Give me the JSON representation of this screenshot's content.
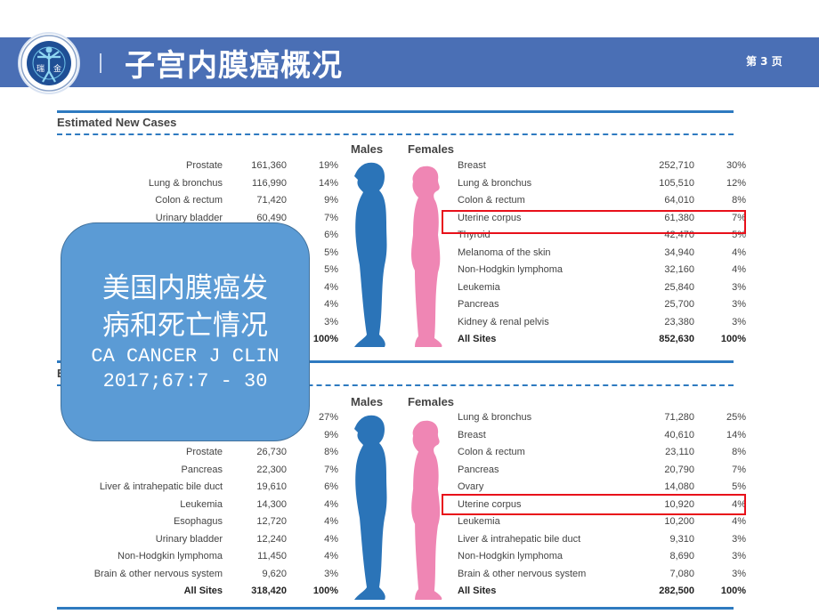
{
  "header": {
    "logo_icon": "hospital-emblem-icon",
    "logo_char_left": "瑞",
    "logo_char_right": "金",
    "title": "子宫内膜癌概况",
    "page_label": "第 3 页",
    "bar_color": "#4a6fb5"
  },
  "new_cases": {
    "title": "Estimated New Cases",
    "males_label": "Males",
    "females_label": "Females",
    "males": [
      {
        "site": "Prostate",
        "count": "161,360",
        "pct": "19%"
      },
      {
        "site": "Lung & bronchus",
        "count": "116,990",
        "pct": "14%"
      },
      {
        "site": "Colon & rectum",
        "count": "71,420",
        "pct": "9%"
      },
      {
        "site": "Urinary bladder",
        "count": "60,490",
        "pct": "7%"
      },
      {
        "site": "",
        "count": "",
        "pct": "6%"
      },
      {
        "site": "",
        "count": "",
        "pct": "5%"
      },
      {
        "site": "",
        "count": "",
        "pct": "5%"
      },
      {
        "site": "",
        "count": "",
        "pct": "4%"
      },
      {
        "site": "",
        "count": "",
        "pct": "4%"
      },
      {
        "site": "",
        "count": "",
        "pct": "3%"
      },
      {
        "site": "",
        "count": "",
        "pct": "100%"
      }
    ],
    "females": [
      {
        "site": "Breast",
        "count": "252,710",
        "pct": "30%"
      },
      {
        "site": "Lung & bronchus",
        "count": "105,510",
        "pct": "12%"
      },
      {
        "site": "Colon & rectum",
        "count": "64,010",
        "pct": "8%"
      },
      {
        "site": "Uterine corpus",
        "count": "61,380",
        "pct": "7%"
      },
      {
        "site": "Thyroid",
        "count": "42,470",
        "pct": "5%"
      },
      {
        "site": "Melanoma of the skin",
        "count": "34,940",
        "pct": "4%"
      },
      {
        "site": "Non-Hodgkin lymphoma",
        "count": "32,160",
        "pct": "4%"
      },
      {
        "site": "Leukemia",
        "count": "25,840",
        "pct": "3%"
      },
      {
        "site": "Pancreas",
        "count": "25,700",
        "pct": "3%"
      },
      {
        "site": "Kidney & renal pelvis",
        "count": "23,380",
        "pct": "3%"
      },
      {
        "site": "All Sites",
        "count": "852,630",
        "pct": "100%"
      }
    ]
  },
  "deaths": {
    "title_visible": "E",
    "males_label": "Males",
    "females_label": "Females",
    "males": [
      {
        "site": "",
        "count": "",
        "pct": "27%"
      },
      {
        "site": "",
        "count": "",
        "pct": "9%"
      },
      {
        "site": "Prostate",
        "count": "26,730",
        "pct": "8%"
      },
      {
        "site": "Pancreas",
        "count": "22,300",
        "pct": "7%"
      },
      {
        "site": "Liver & intrahepatic bile duct",
        "count": "19,610",
        "pct": "6%"
      },
      {
        "site": "Leukemia",
        "count": "14,300",
        "pct": "4%"
      },
      {
        "site": "Esophagus",
        "count": "12,720",
        "pct": "4%"
      },
      {
        "site": "Urinary bladder",
        "count": "12,240",
        "pct": "4%"
      },
      {
        "site": "Non-Hodgkin lymphoma",
        "count": "11,450",
        "pct": "4%"
      },
      {
        "site": "Brain & other nervous system",
        "count": "9,620",
        "pct": "3%"
      },
      {
        "site": "All Sites",
        "count": "318,420",
        "pct": "100%"
      }
    ],
    "females": [
      {
        "site": "Lung & bronchus",
        "count": "71,280",
        "pct": "25%"
      },
      {
        "site": "Breast",
        "count": "40,610",
        "pct": "14%"
      },
      {
        "site": "Colon & rectum",
        "count": "23,110",
        "pct": "8%"
      },
      {
        "site": "Pancreas",
        "count": "20,790",
        "pct": "7%"
      },
      {
        "site": "Ovary",
        "count": "14,080",
        "pct": "5%"
      },
      {
        "site": "Uterine corpus",
        "count": "10,920",
        "pct": "4%"
      },
      {
        "site": "Leukemia",
        "count": "10,200",
        "pct": "4%"
      },
      {
        "site": "Liver & intrahepatic bile duct",
        "count": "9,310",
        "pct": "3%"
      },
      {
        "site": "Non-Hodgkin lymphoma",
        "count": "8,690",
        "pct": "3%"
      },
      {
        "site": "Brain & other nervous system",
        "count": "7,080",
        "pct": "3%"
      },
      {
        "site": "All Sites",
        "count": "282,500",
        "pct": "100%"
      }
    ]
  },
  "callout": {
    "line1": "美国内膜癌发",
    "line2": "病和死亡情况",
    "line3": "CA CANCER J CLIN",
    "line4": "2017;67:7 - 30",
    "color": "#5b9bd5"
  },
  "colors": {
    "male_figure": "#2b74b8",
    "female_figure": "#ef86b4",
    "highlight_box": "#e8101a",
    "rule": "#2e7ac0"
  }
}
